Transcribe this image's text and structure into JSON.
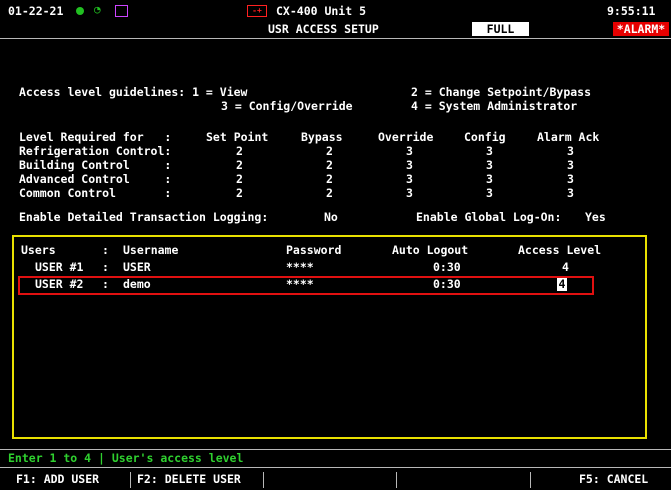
{
  "header": {
    "date": "01-22-21",
    "device_title": "CX-400 Unit 5",
    "screen_title": "USR ACCESS SETUP",
    "mode_badge": "FULL",
    "time": "9:55:11",
    "alarm_badge": "*ALARM*",
    "red_icon_text": "-+"
  },
  "guidelines": {
    "line1_left": "Access level guidelines: 1 = View",
    "line1_right": "2 = Change Setpoint/Bypass",
    "line2_left": "3 = Config/Override",
    "line2_right": "4 = System Administrator"
  },
  "levels_table": {
    "headers": [
      "Level Required for   :",
      "Set Point",
      "Bypass",
      "Override",
      "Config",
      "Alarm Ack"
    ],
    "rows": [
      {
        "label": "Refrigeration Control:",
        "values": [
          "2",
          "2",
          "3",
          "3",
          "3"
        ]
      },
      {
        "label": "Building Control     :",
        "values": [
          "2",
          "2",
          "3",
          "3",
          "3"
        ]
      },
      {
        "label": "Advanced Control     :",
        "values": [
          "2",
          "2",
          "3",
          "3",
          "3"
        ]
      },
      {
        "label": "Common Control       :",
        "values": [
          "2",
          "2",
          "3",
          "3",
          "3"
        ]
      }
    ],
    "logging_label": "Enable Detailed Transaction Logging:",
    "logging_value": "No",
    "global_logon_label": "Enable Global Log-On:",
    "global_logon_value": "Yes"
  },
  "users": {
    "headers": {
      "users": "Users",
      "sep": ":",
      "username": "Username",
      "password": "Password",
      "auto_logout": "Auto Logout",
      "access_level": "Access Level"
    },
    "rows": [
      {
        "user": "USER #1",
        "username": "USER",
        "password": "****",
        "auto_logout": "0:30",
        "access_level": "4"
      },
      {
        "user": "USER #2",
        "username": "demo",
        "password": "****",
        "auto_logout": "0:30",
        "access_level": "4"
      }
    ]
  },
  "status_line": "Enter 1 to 4 | User's access level",
  "fkeys": {
    "f1": "F1: ADD USER",
    "f2": "F2: DELETE USER",
    "f5": "F5: CANCEL"
  }
}
